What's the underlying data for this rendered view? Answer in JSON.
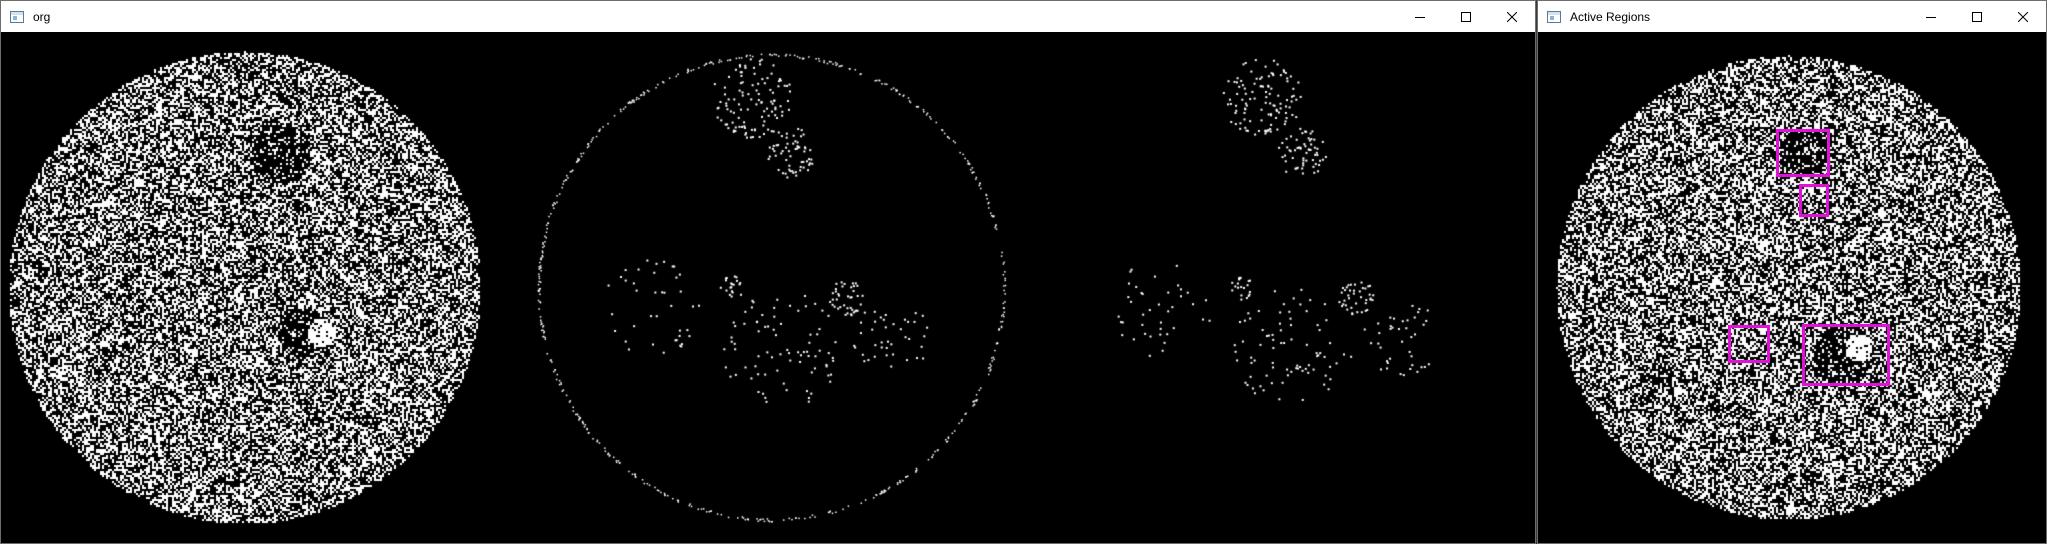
{
  "windows": {
    "org": {
      "title": "org",
      "icon": "app-window-icon",
      "controls": [
        "minimize-icon",
        "maximize-icon",
        "close-icon"
      ]
    },
    "active_regions": {
      "title": "Active Regions",
      "icon": "app-window-icon",
      "controls": [
        "minimize-icon",
        "maximize-icon",
        "close-icon"
      ],
      "highlight_color": "#e012d8",
      "detected_regions_count": 4
    }
  },
  "colors": {
    "titlebar_bg": "#ffffff",
    "image_bg": "#000000",
    "noise": "#ffffff",
    "box": "#e012d8"
  }
}
